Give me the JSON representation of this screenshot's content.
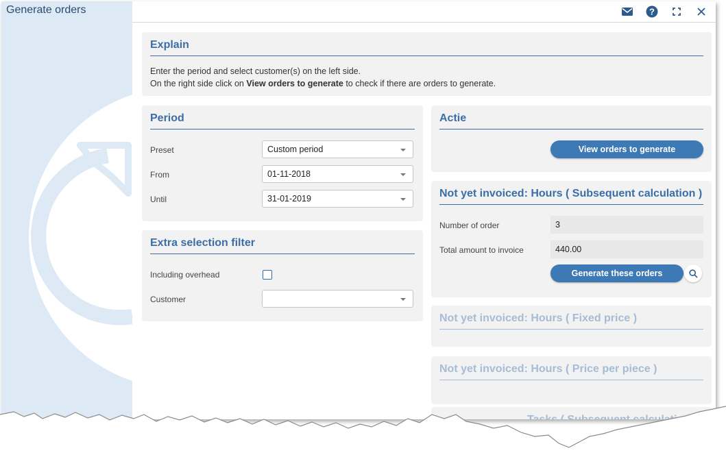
{
  "window": {
    "title": "Generate orders"
  },
  "titlebar": {
    "icons": [
      "mail-icon",
      "help-icon",
      "fullscreen-icon",
      "close-icon"
    ]
  },
  "explain": {
    "title": "Explain",
    "line1": "Enter the period and select customer(s) on the left side.",
    "line2_prefix": "On the right side click on ",
    "line2_bold": "View orders to generate",
    "line2_suffix": " to check if there are orders to generate."
  },
  "period": {
    "title": "Period",
    "preset_label": "Preset",
    "preset_value": "Custom period",
    "from_label": "From",
    "from_value": "01-11-2018",
    "until_label": "Until",
    "until_value": "31-01-2019"
  },
  "filter": {
    "title": "Extra selection filter",
    "overhead_label": "Including overhead",
    "overhead_checked": false,
    "customer_label": "Customer",
    "customer_value": ""
  },
  "actie": {
    "title": "Actie",
    "view_button": "View orders to generate"
  },
  "subsequent": {
    "title": "Not yet invoiced: Hours ( Subsequent calculation )",
    "orders_label": "Number of order",
    "orders_value": "3",
    "amount_label": "Total amount to invoice",
    "amount_value": "440.00",
    "generate_button": "Generate these orders"
  },
  "fixed": {
    "title": "Not yet invoiced: Hours ( Fixed price )"
  },
  "piece": {
    "title": "Not yet invoiced: Hours ( Price per piece )"
  },
  "tasks": {
    "title": "Tasks ( Subsequent calculation )"
  },
  "colors": {
    "accent": "#3a6ea5",
    "button": "#3d79b5",
    "sidebar": "#dde9f5",
    "muted_title": "#a6bcd4"
  }
}
